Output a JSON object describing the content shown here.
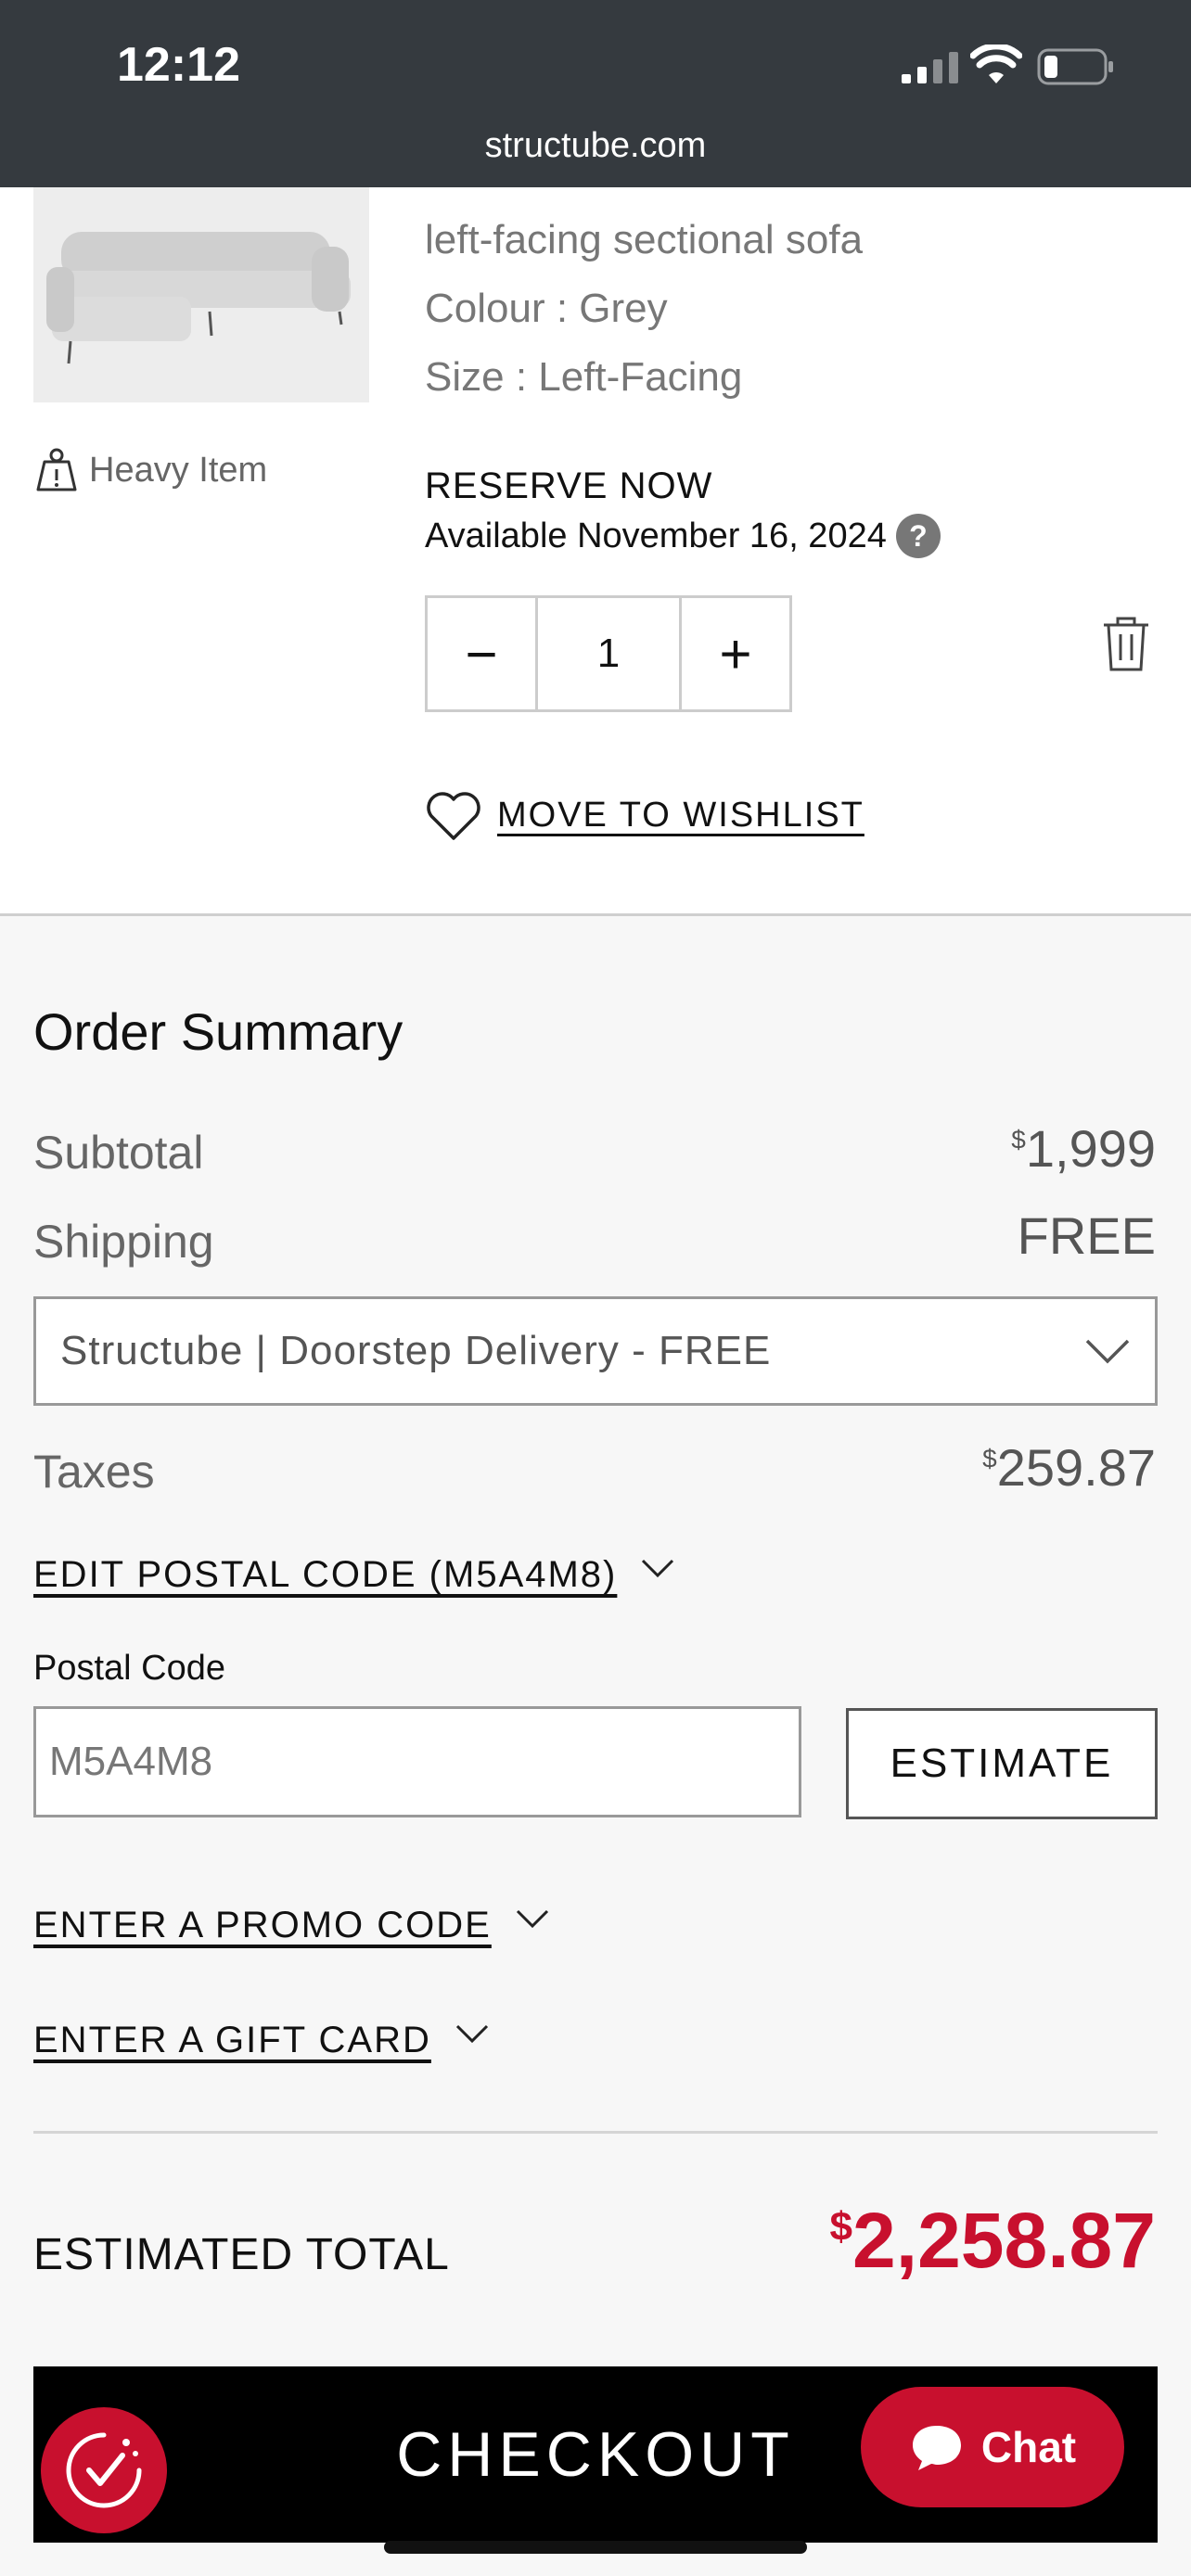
{
  "status_bar": {
    "time": "12:12",
    "url": "structube.com"
  },
  "product": {
    "name": "left-facing sectional sofa",
    "colour": "Colour : Grey",
    "size": "Size : Left-Facing",
    "heavy_label": "Heavy Item",
    "reserve_label": "RESERVE NOW",
    "availability": "Available November 16, 2024",
    "help_label": "?",
    "quantity": "1",
    "minus_label": "−",
    "plus_label": "+",
    "wishlist_label": "MOVE TO WISHLIST"
  },
  "order_summary": {
    "title": "Order Summary",
    "subtotal_label": "Subtotal",
    "currency": "$",
    "subtotal_value": "1,999",
    "shipping_label": "Shipping",
    "shipping_value": "FREE",
    "delivery_option": "Structube | Doorstep Delivery - FREE",
    "taxes_label": "Taxes",
    "taxes_value": "259.87",
    "edit_postal_label": "EDIT POSTAL CODE (M5A4M8)",
    "postal_code_label": "Postal Code",
    "postal_code_value": "M5A4M8",
    "estimate_label": "ESTIMATE",
    "promo_label": "ENTER A PROMO CODE",
    "gift_card_label": "ENTER A GIFT CARD",
    "total_label": "ESTIMATED TOTAL",
    "total_value": "2,258.87"
  },
  "checkout": {
    "label": "CHECKOUT",
    "chat_label": "Chat"
  },
  "colors": {
    "accent": "#c8102e",
    "status_bar": "#353a3f",
    "background": "#f7f7f7"
  }
}
